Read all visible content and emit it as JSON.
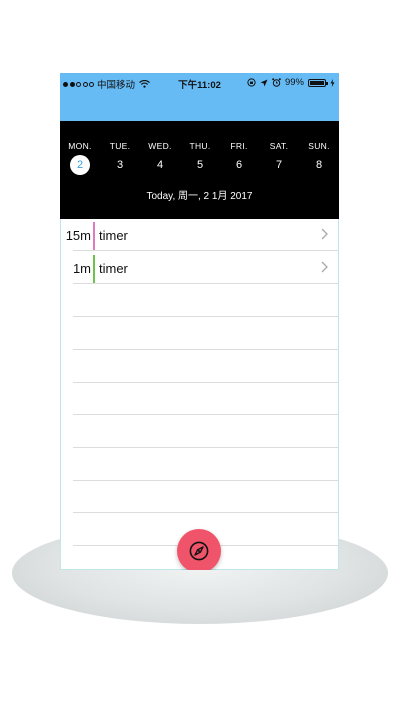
{
  "status_bar": {
    "carrier": "中国移动",
    "time": "下午11:02",
    "battery_percent": "99%",
    "battery_level": 0.99,
    "signal_bars_filled": 2
  },
  "week": {
    "days": [
      {
        "name": "MON.",
        "num": "2",
        "selected": true
      },
      {
        "name": "TUE.",
        "num": "3"
      },
      {
        "name": "WED.",
        "num": "4"
      },
      {
        "name": "THU.",
        "num": "5"
      },
      {
        "name": "FRI.",
        "num": "6"
      },
      {
        "name": "SAT.",
        "num": "7"
      },
      {
        "name": "SUN.",
        "num": "8"
      }
    ],
    "today_label": "Today, 周一, 2 1月 2017"
  },
  "entries": [
    {
      "duration": "15m",
      "title": "timer",
      "color": "#e07ac0"
    },
    {
      "duration": "1m",
      "title": "timer",
      "color": "#6cc24a"
    }
  ],
  "colors": {
    "header": "#66bbf4",
    "week_bg": "#000000",
    "fab": "#f0546b",
    "selected_day": "#3b9ee0"
  },
  "fab_icon": "compass-icon",
  "chevron_icon": "chevron-right-icon"
}
